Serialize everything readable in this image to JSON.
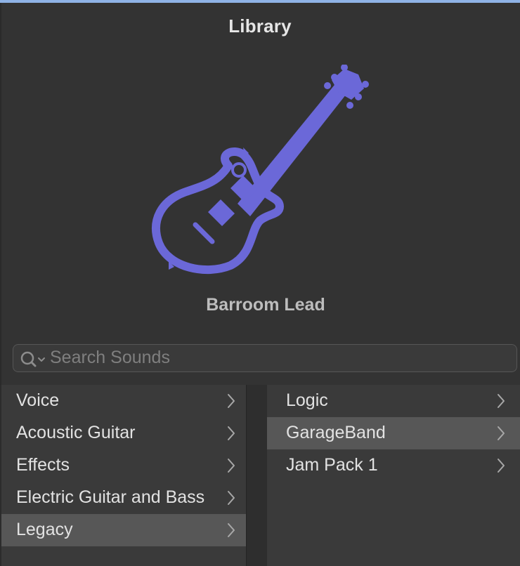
{
  "library": {
    "title": "Library",
    "patch_name": "Barroom Lead",
    "icon": "electric-guitar-icon",
    "accent_color": "#6b68d8"
  },
  "search": {
    "placeholder": "Search Sounds",
    "value": ""
  },
  "categories": {
    "items": [
      {
        "label": "Voice",
        "selected": false
      },
      {
        "label": "Acoustic Guitar",
        "selected": false
      },
      {
        "label": "Effects",
        "selected": false
      },
      {
        "label": "Electric Guitar and Bass",
        "selected": false
      },
      {
        "label": "Legacy",
        "selected": true
      }
    ]
  },
  "subcategories": {
    "items": [
      {
        "label": "Logic",
        "selected": false
      },
      {
        "label": "GarageBand",
        "selected": true
      },
      {
        "label": "Jam Pack 1",
        "selected": false
      }
    ]
  }
}
